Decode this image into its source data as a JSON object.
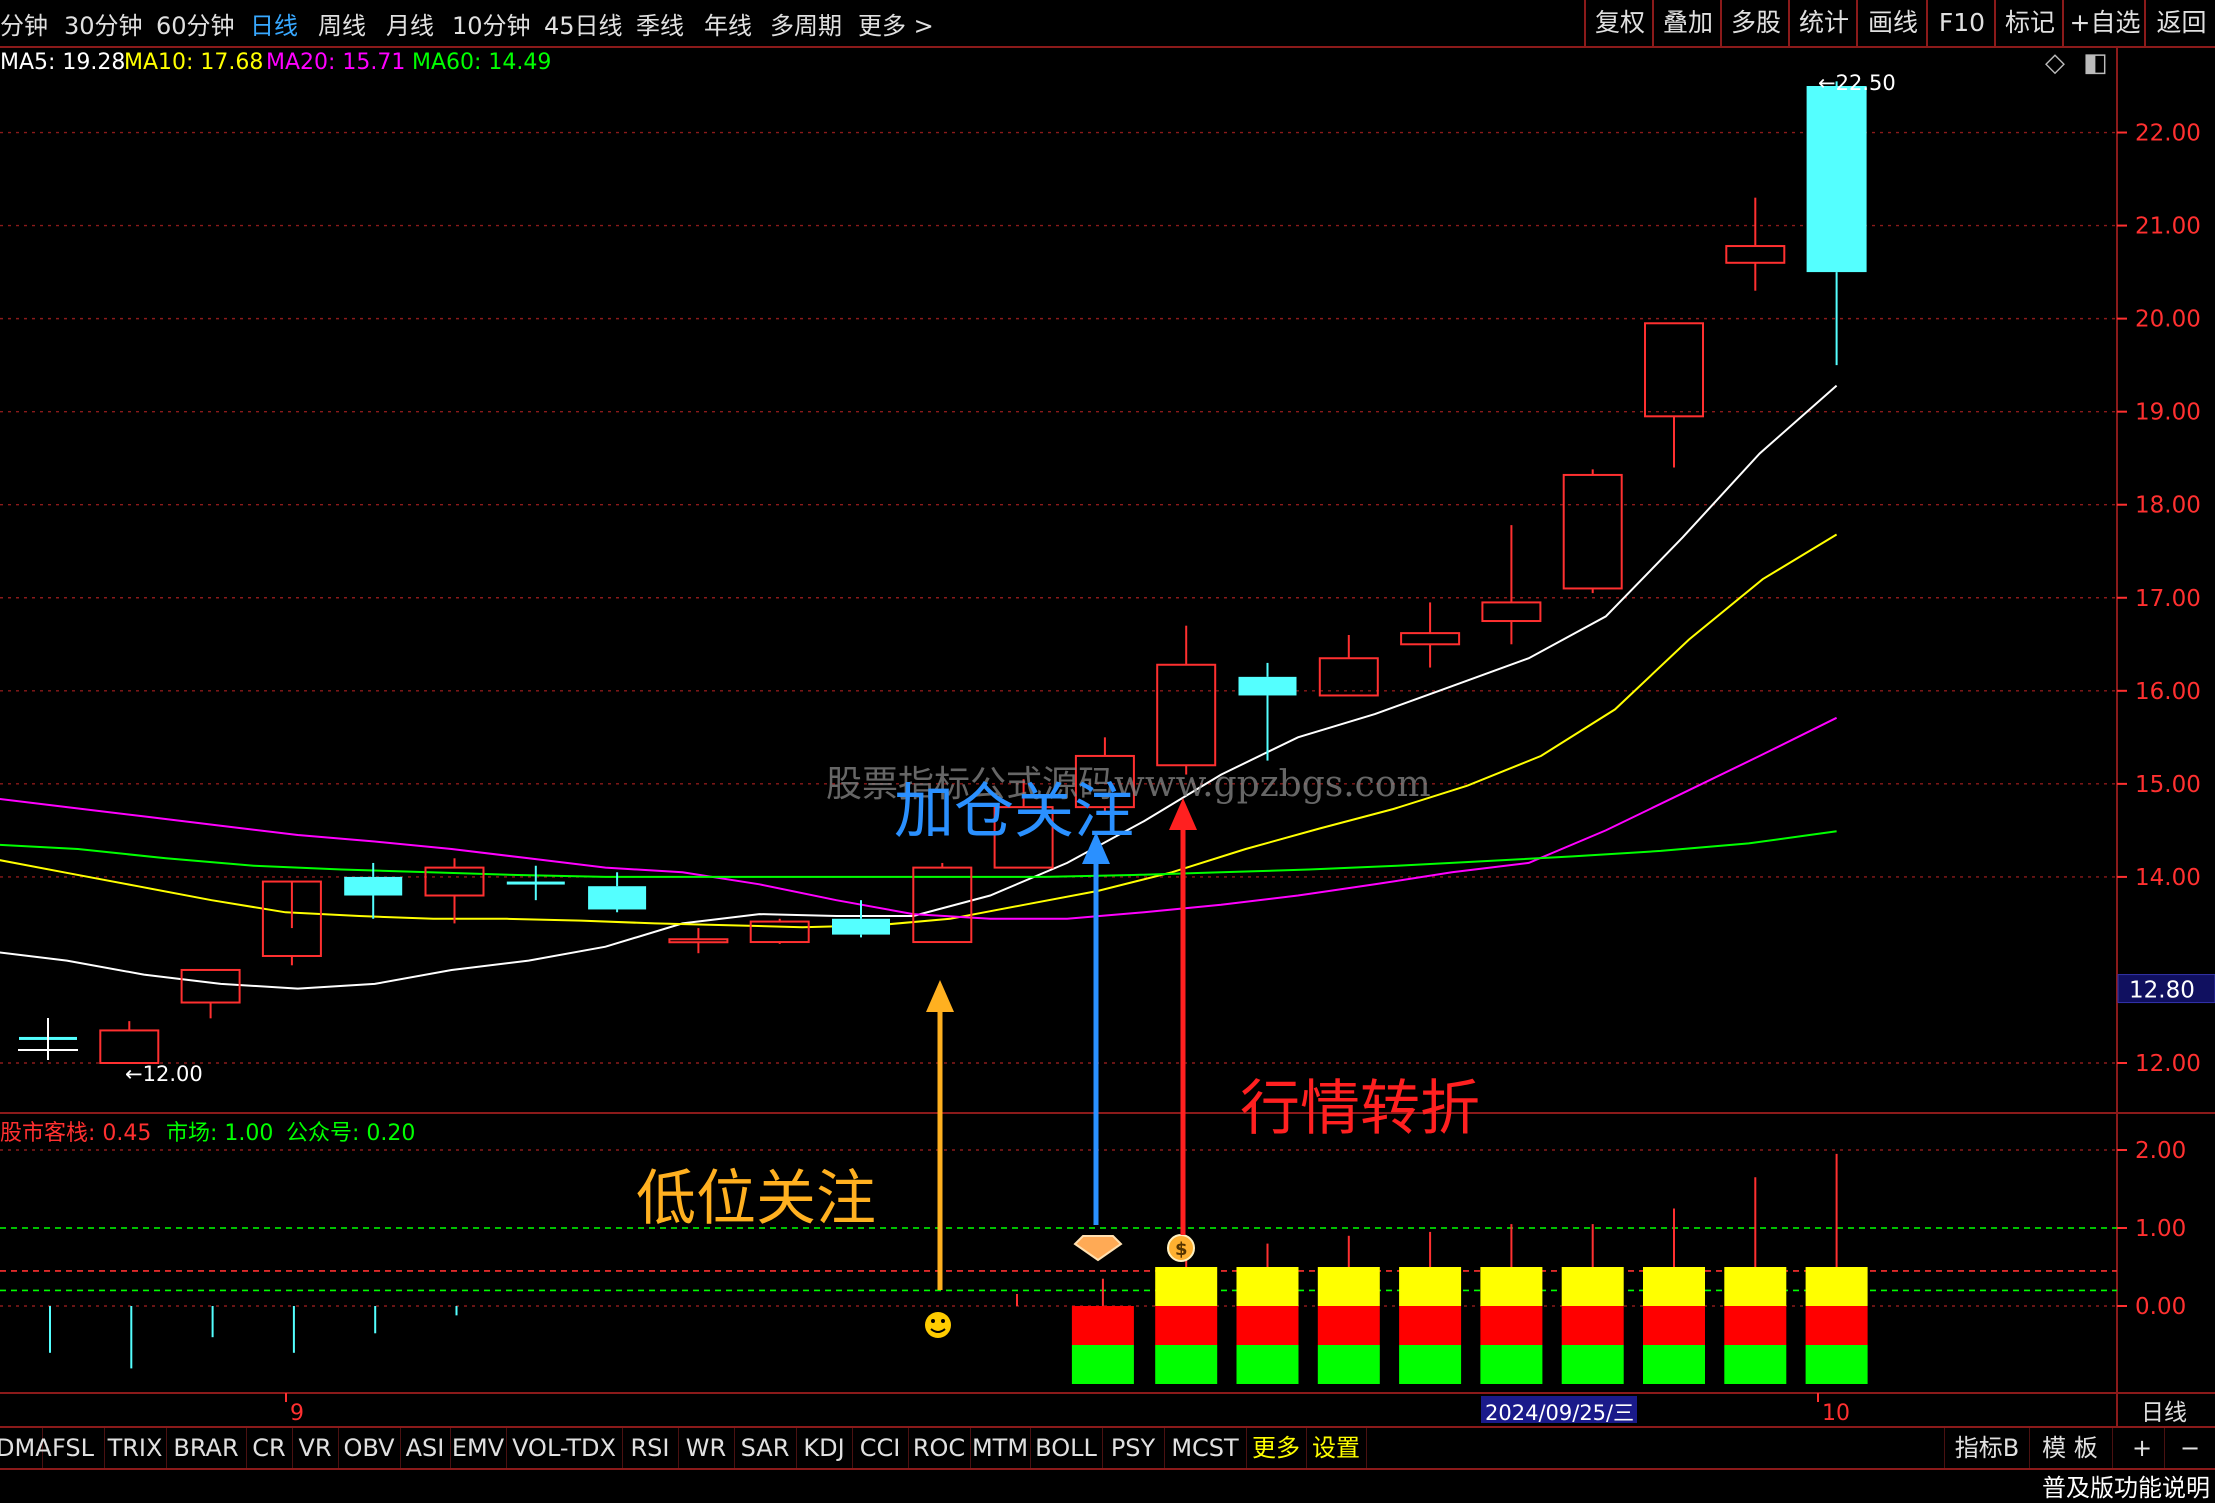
{
  "period_tabs": [
    {
      "label": "分钟",
      "active": false
    },
    {
      "label": "30分钟",
      "active": false
    },
    {
      "label": "60分钟",
      "active": false
    },
    {
      "label": "日线",
      "active": true
    },
    {
      "label": "周线",
      "active": false
    },
    {
      "label": "月线",
      "active": false
    },
    {
      "label": "10分钟",
      "active": false
    },
    {
      "label": "45日线",
      "active": false
    },
    {
      "label": "季线",
      "active": false
    },
    {
      "label": "年线",
      "active": false
    },
    {
      "label": "多周期",
      "active": false
    },
    {
      "label": "更多",
      "active": false
    }
  ],
  "right_tools": [
    "复权",
    "叠加",
    "多股",
    "统计",
    "画线",
    "F10",
    "标记",
    "+自选",
    "返回"
  ],
  "ma_legend": [
    {
      "label": "MA5: 19.28",
      "color": "#ffffff"
    },
    {
      "label": "MA10: 17.68",
      "color": "#ffff00"
    },
    {
      "label": "MA20: 15.71",
      "color": "#ff00ff"
    },
    {
      "label": "MA60: 14.49",
      "color": "#00ff00"
    }
  ],
  "ind_legend": [
    {
      "label": "股市客栈: 0.45",
      "color": "#ff3030"
    },
    {
      "label": "市场: 1.00",
      "color": "#00ff00"
    },
    {
      "label": "公众号: 0.20",
      "color": "#00ff00"
    }
  ],
  "price_axis": [
    "22.00",
    "21.00",
    "20.00",
    "19.00",
    "18.00",
    "17.00",
    "16.00",
    "15.00",
    "14.00",
    "12.00"
  ],
  "price_cursor": "12.80",
  "ind_axis": [
    "2.00",
    "1.00",
    "0.00"
  ],
  "high_label": "22.50",
  "low_label": "12.00",
  "date_labels": {
    "left": "9",
    "selected": "2024/09/25/三",
    "right": "10"
  },
  "period_label": "日线",
  "annotations": {
    "low": "低位关注",
    "add": "加仓关注",
    "turn": "行情转折",
    "watermark": "股票指标公式源码www.gpzbgs.com"
  },
  "indicator_tabs": [
    "DMA",
    "FSL",
    "TRIX",
    "BRAR",
    "CR",
    "VR",
    "OBV",
    "ASI",
    "EMV",
    "VOL-TDX",
    "RSI",
    "WR",
    "SAR",
    "KDJ",
    "CCI",
    "ROC",
    "MTM",
    "BOLL",
    "PSY",
    "MCST",
    "更多",
    "设置"
  ],
  "right_bottom_tabs": [
    "指标B",
    "模 板",
    "+",
    "−"
  ],
  "status_text": "普及版功能说明",
  "colors": {
    "up": "#ff3030",
    "down": "#54ffff",
    "frame": "#8b1a1a",
    "axis_text": "#ff3030"
  },
  "chart_data": {
    "type": "candlestick",
    "ylim": [
      11.6,
      22.7
    ],
    "candles": [
      {
        "o": 12.28,
        "h": 12.42,
        "l": 12.05,
        "c": 12.28
      },
      {
        "o": 12.0,
        "h": 12.45,
        "l": 12.0,
        "c": 12.35
      },
      {
        "o": 12.65,
        "h": 13.0,
        "l": 12.48,
        "c": 13.0
      },
      {
        "o": 13.15,
        "h": 13.45,
        "l": 13.05,
        "c": 13.95
      },
      {
        "o": 14.0,
        "h": 14.15,
        "l": 13.55,
        "c": 13.8
      },
      {
        "o": 13.8,
        "h": 14.2,
        "l": 13.5,
        "c": 14.1
      },
      {
        "o": 13.95,
        "h": 14.12,
        "l": 13.75,
        "c": 13.95
      },
      {
        "o": 13.9,
        "h": 14.05,
        "l": 13.62,
        "c": 13.65
      },
      {
        "o": 13.3,
        "h": 13.45,
        "l": 13.18,
        "c": 13.33
      },
      {
        "o": 13.3,
        "h": 13.55,
        "l": 13.28,
        "c": 13.52
      },
      {
        "o": 13.55,
        "h": 13.75,
        "l": 13.35,
        "c": 13.38
      },
      {
        "o": 13.3,
        "h": 14.15,
        "l": 13.3,
        "c": 14.1
      },
      {
        "o": 14.1,
        "h": 15.05,
        "l": 14.1,
        "c": 14.75
      },
      {
        "o": 14.75,
        "h": 15.5,
        "l": 14.7,
        "c": 15.3
      },
      {
        "o": 15.2,
        "h": 16.7,
        "l": 15.1,
        "c": 16.28
      },
      {
        "o": 16.15,
        "h": 16.3,
        "l": 15.25,
        "c": 15.95
      },
      {
        "o": 15.95,
        "h": 16.6,
        "l": 15.95,
        "c": 16.35
      },
      {
        "o": 16.5,
        "h": 16.95,
        "l": 16.25,
        "c": 16.62
      },
      {
        "o": 16.75,
        "h": 17.78,
        "l": 16.5,
        "c": 16.95
      },
      {
        "o": 17.1,
        "h": 18.38,
        "l": 17.05,
        "c": 18.32
      },
      {
        "o": 18.95,
        "h": 19.95,
        "l": 18.4,
        "c": 19.95
      },
      {
        "o": 20.6,
        "h": 21.3,
        "l": 20.3,
        "c": 20.78
      },
      {
        "o": 22.5,
        "h": 22.55,
        "l": 19.5,
        "c": 20.5
      }
    ],
    "ma_lines": [
      {
        "name": "MA5",
        "color": "#ffffff",
        "values": [
          13.2,
          13.1,
          12.95,
          12.85,
          12.8,
          12.85,
          13.0,
          13.1,
          13.25,
          13.5,
          13.6,
          13.58,
          13.58,
          13.8,
          14.15,
          14.6,
          15.1,
          15.5,
          15.75,
          16.05,
          16.35,
          16.8,
          17.65,
          18.55,
          19.28
        ]
      },
      {
        "name": "MA10",
        "color": "#ffff00",
        "values": [
          14.2,
          14.05,
          13.9,
          13.75,
          13.62,
          13.58,
          13.55,
          13.55,
          13.53,
          13.5,
          13.48,
          13.46,
          13.48,
          13.55,
          13.7,
          13.85,
          14.05,
          14.3,
          14.52,
          14.73,
          14.98,
          15.3,
          15.8,
          16.55,
          17.2,
          17.68
        ]
      },
      {
        "name": "MA20",
        "color": "#ff00ff",
        "values": [
          14.85,
          14.75,
          14.65,
          14.55,
          14.45,
          14.38,
          14.3,
          14.2,
          14.1,
          14.05,
          13.92,
          13.75,
          13.6,
          13.55,
          13.55,
          13.62,
          13.7,
          13.8,
          13.92,
          14.05,
          14.15,
          14.5,
          14.9,
          15.3,
          15.71
        ]
      },
      {
        "name": "MA60",
        "color": "#00ff00",
        "values": [
          14.35,
          14.3,
          14.2,
          14.12,
          14.08,
          14.05,
          14.02,
          14.0,
          14.0,
          14.0,
          14.0,
          14.0,
          14.0,
          14.02,
          14.05,
          14.08,
          14.12,
          14.17,
          14.22,
          14.28,
          14.36,
          14.49
        ]
      }
    ],
    "indicator": {
      "ylim": [
        -1.0,
        2.3
      ],
      "ref_lines": [
        1.0,
        0.45,
        0.2
      ],
      "early_ticks": [
        -0.6,
        -0.8,
        -0.4,
        -0.6,
        -0.35,
        -0.12
      ],
      "stack_start_index": 13,
      "stacks": [
        {
          "green": -1.0,
          "red": -0.5,
          "yellow": 0.0
        },
        {
          "green": -1.0,
          "red": -0.5,
          "yellow": 0.5
        },
        {
          "green": -1.0,
          "red": -0.5,
          "yellow": 0.5
        },
        {
          "green": -1.0,
          "red": -0.5,
          "yellow": 0.5
        },
        {
          "green": -1.0,
          "red": -0.5,
          "yellow": 0.5
        },
        {
          "green": -1.0,
          "red": -0.5,
          "yellow": 0.5
        },
        {
          "green": -1.0,
          "red": -0.5,
          "yellow": 0.5
        },
        {
          "green": -1.0,
          "red": -0.5,
          "yellow": 0.5
        },
        {
          "green": -1.0,
          "red": -0.5,
          "yellow": 0.5
        },
        {
          "green": -1.0,
          "red": -0.5,
          "yellow": 0.5
        }
      ],
      "stack_wicks": [
        0.35,
        0.75,
        0.8,
        0.9,
        0.95,
        1.05,
        1.05,
        1.25,
        1.65,
        1.95
      ]
    }
  }
}
